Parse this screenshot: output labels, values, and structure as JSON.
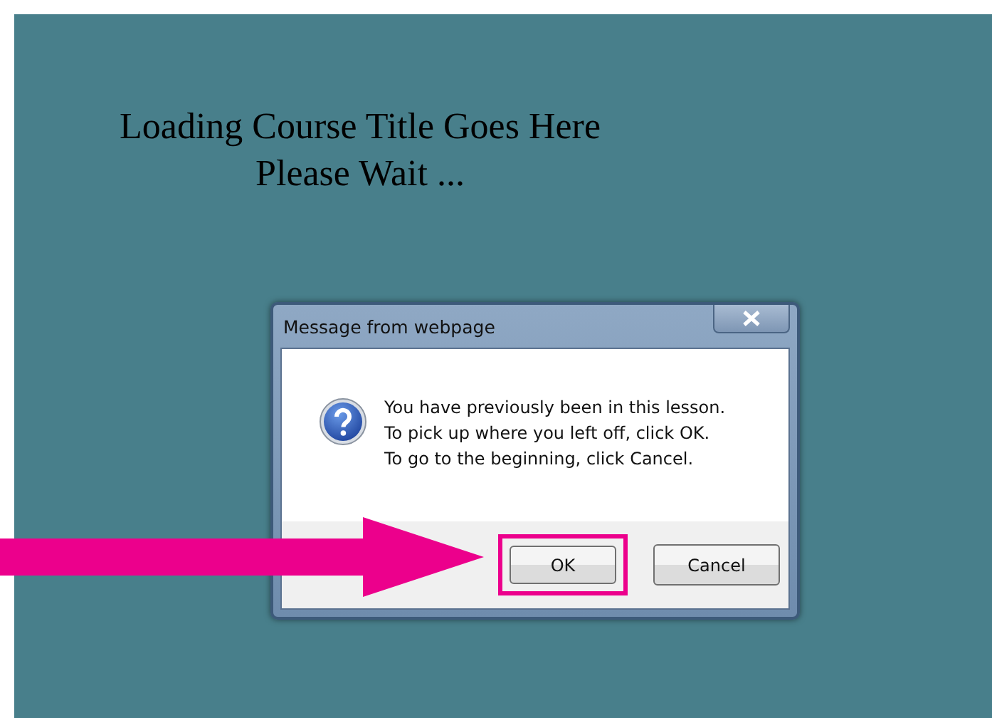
{
  "heading": [
    "Loading Course Title Goes Here",
    "Please Wait ..."
  ],
  "dialog": {
    "title": "Message from webpage",
    "message": [
      "You have previously been in this lesson.",
      "To pick up where you left off, click OK.",
      "To go to the beginning, click Cancel."
    ],
    "buttons": [
      {
        "label": "OK",
        "highlighted": true
      },
      {
        "label": "Cancel",
        "highlighted": false
      }
    ]
  }
}
